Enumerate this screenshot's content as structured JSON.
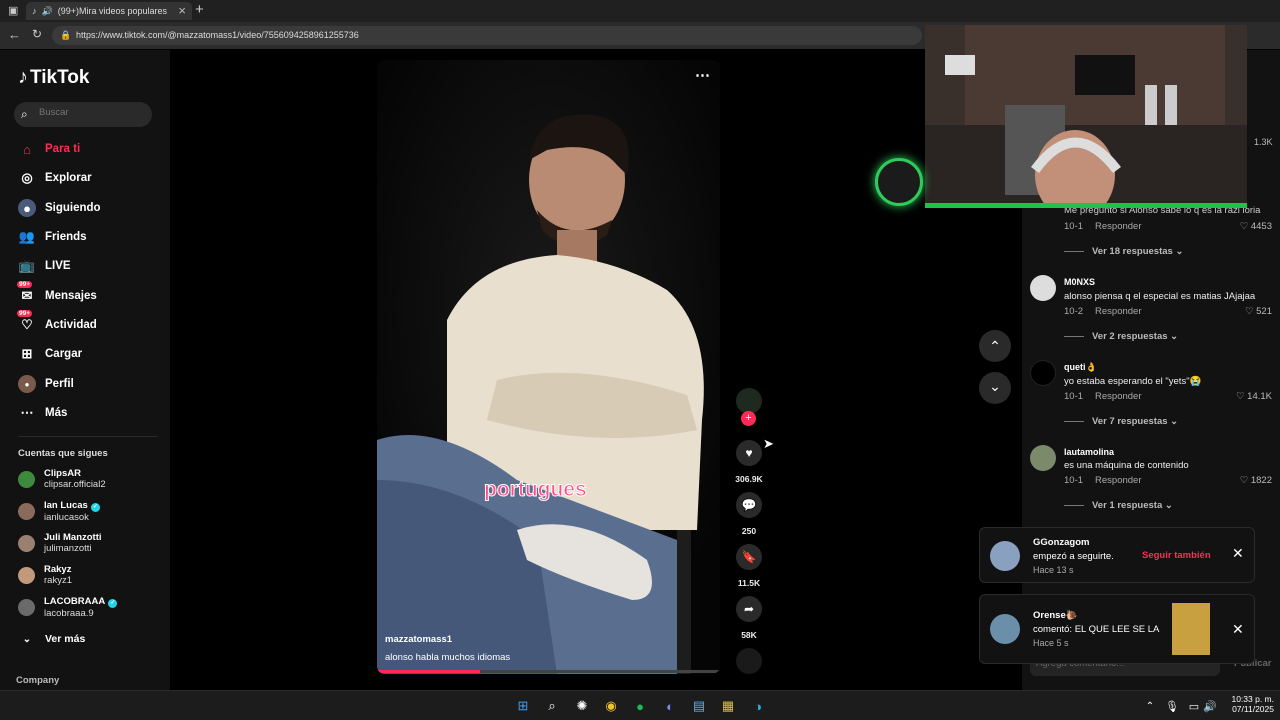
{
  "browser": {
    "tab_title": "(99+)Mira videos populares",
    "url": "https://www.tiktok.com/@mazzatomass1/video/7556094258961255736"
  },
  "sidebar": {
    "logo": "TikTok",
    "search_placeholder": "Buscar",
    "nav": [
      {
        "label": "Para ti",
        "icon": "home-icon",
        "active": true
      },
      {
        "label": "Explorar",
        "icon": "compass-icon"
      },
      {
        "label": "Siguiendo",
        "icon": "following-icon"
      },
      {
        "label": "Friends",
        "icon": "friends-icon"
      },
      {
        "label": "LIVE",
        "icon": "live-icon"
      },
      {
        "label": "Mensajes",
        "icon": "messages-icon",
        "badge": "99+"
      },
      {
        "label": "Actividad",
        "icon": "activity-icon",
        "badge": "99+"
      },
      {
        "label": "Cargar",
        "icon": "upload-icon"
      },
      {
        "label": "Perfil",
        "icon": "profile-icon"
      },
      {
        "label": "Más",
        "icon": "more-icon"
      }
    ],
    "following_heading": "Cuentas que sigues",
    "accounts": [
      {
        "name": "ClipsAR",
        "handle": "clipsar.official2",
        "verified": false
      },
      {
        "name": "Ian Lucas",
        "handle": "ianlucasok",
        "verified": true
      },
      {
        "name": "Juli Manzotti",
        "handle": "julimanzotti",
        "verified": false
      },
      {
        "name": "Rakyz",
        "handle": "rakyz1",
        "verified": false
      },
      {
        "name": "LACOBRAAA",
        "handle": "lacobraaa.9",
        "verified": true
      }
    ],
    "see_more": "Ver más",
    "footer": "Company"
  },
  "video": {
    "caption_overlay": "portugues",
    "author": "mazzatomass1",
    "description": "alonso habla muchos idiomas",
    "progress": 0.3,
    "likes": "306.9K",
    "comments": "250",
    "saves": "11.5K",
    "shares": "58K"
  },
  "right_panel": {
    "count_top": "1.3K"
  },
  "comments": [
    {
      "text": "Me pregunto si Alonso sabe lo q es la razi loria",
      "date": "10-1",
      "reply": "Responder",
      "likes": "4453",
      "more": "Ver 18 respuestas"
    },
    {
      "name": "M0NXS",
      "text": "alonso piensa q el especial es matias JAjajaa",
      "date": "10-2",
      "reply": "Responder",
      "likes": "521",
      "more": "Ver 2 respuestas"
    },
    {
      "name": "queti👌",
      "text": "yo estaba esperando el \"yets\"😭",
      "date": "10-1",
      "reply": "Responder",
      "likes": "14.1K",
      "more": "Ver 7 respuestas"
    },
    {
      "name": "lautamolina",
      "text": "es una máquina de contenido",
      "date": "10-1",
      "reply": "Responder",
      "likes": "1822",
      "more": "Ver 1 respuesta"
    }
  ],
  "notifications": [
    {
      "name": "GGonzagom",
      "text": "empezó a seguirte.",
      "time": "Hace 13 s",
      "action": "Seguir también"
    },
    {
      "name": "Orense🐌",
      "text": "comentó: EL QUE LEE SE LA",
      "time": "Hace 5 s"
    }
  ],
  "comment_input": {
    "placeholder": "Agrega comentario...",
    "post": "Publicar"
  },
  "taskbar": {
    "time": "10:33 p. m.",
    "date": "07/11/2025"
  },
  "colors": {
    "accent": "#fe2c55",
    "bg": "#000000",
    "panel": "#121212"
  }
}
